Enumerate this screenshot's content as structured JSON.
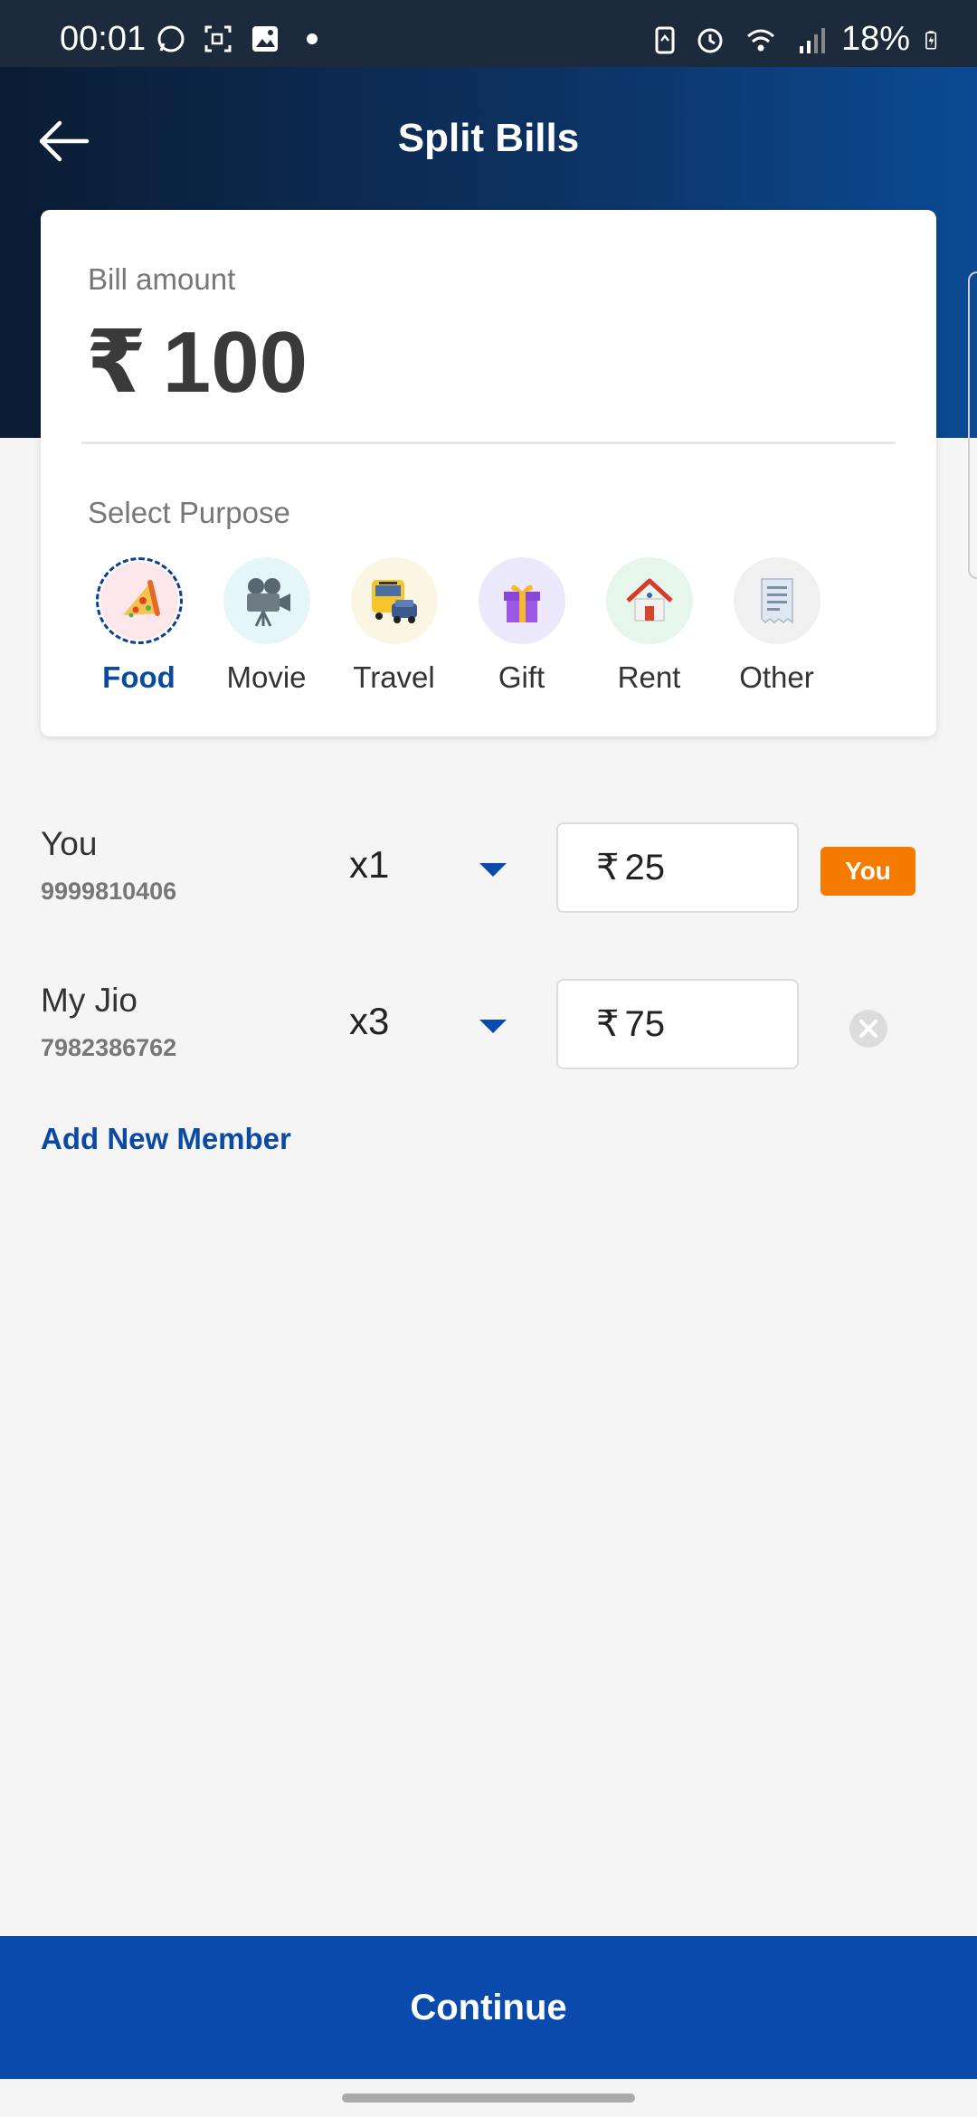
{
  "status_bar": {
    "time": "00:01",
    "battery": "18%",
    "left_icons": [
      "whatsapp-icon",
      "screen-record-icon",
      "gallery-icon",
      "dot-icon"
    ],
    "right_icons": [
      "battery-saver-icon",
      "alarm-icon",
      "wifi-icon",
      "signal-icon",
      "battery-icon"
    ]
  },
  "header": {
    "title": "Split Bills",
    "back_icon": "back-arrow-icon"
  },
  "bill": {
    "label": "Bill amount",
    "currency": "₹",
    "amount": "100"
  },
  "purpose": {
    "label": "Select Purpose",
    "items": [
      {
        "label": "Food",
        "icon": "pizza-icon",
        "bg": "#fde7ea",
        "selected": true
      },
      {
        "label": "Movie",
        "icon": "movie-camera-icon",
        "bg": "#e4f6f8",
        "selected": false
      },
      {
        "label": "Travel",
        "icon": "bus-icon",
        "bg": "#fbf6e4",
        "selected": false
      },
      {
        "label": "Gift",
        "icon": "gift-icon",
        "bg": "#ebe9fb",
        "selected": false
      },
      {
        "label": "Rent",
        "icon": "house-icon",
        "bg": "#e7f6ea",
        "selected": false
      },
      {
        "label": "Other",
        "icon": "receipt-icon",
        "bg": "#f0f0f0",
        "selected": false
      }
    ]
  },
  "members": [
    {
      "name": "You",
      "phone": "9999810406",
      "multiplier": "x1",
      "currency": "₹",
      "amount": "25",
      "badge": "You"
    },
    {
      "name": "My Jio",
      "phone": "7982386762",
      "multiplier": "x3",
      "currency": "₹",
      "amount": "75"
    }
  ],
  "add_member_label": "Add New Member",
  "continue_label": "Continue",
  "colors": {
    "primary": "#0b4aad",
    "badge": "#f47b00",
    "selected_text": "#0b4aa2"
  }
}
